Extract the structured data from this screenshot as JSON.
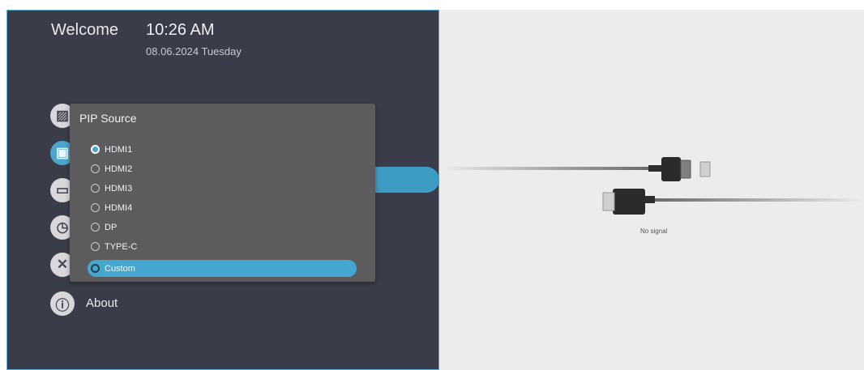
{
  "header": {
    "welcome": "Welcome",
    "time": "10:26 AM",
    "date": "08.06.2024 Tuesday"
  },
  "menu": {
    "items": [
      {
        "icon": "picture-icon",
        "label": ""
      },
      {
        "icon": "display-icon",
        "label": ""
      },
      {
        "icon": "screen-icon",
        "label": ""
      },
      {
        "icon": "clock-icon",
        "label": ""
      },
      {
        "icon": "tools-icon",
        "label": ""
      },
      {
        "icon": "info-icon",
        "label": "About"
      }
    ]
  },
  "dialog": {
    "title": "PIP Source",
    "options": [
      {
        "label": "HDMI1",
        "checked": true,
        "highlighted": false
      },
      {
        "label": "HDMI2",
        "checked": false,
        "highlighted": false
      },
      {
        "label": "HDMI3",
        "checked": false,
        "highlighted": false
      },
      {
        "label": "HDMI4",
        "checked": false,
        "highlighted": false
      },
      {
        "label": "DP",
        "checked": false,
        "highlighted": false
      },
      {
        "label": "TYPE-C",
        "checked": false,
        "highlighted": false
      },
      {
        "label": "Custom",
        "checked": false,
        "highlighted": true
      }
    ]
  },
  "preview": {
    "status": "No signal"
  },
  "colors": {
    "accent": "#45a7cf",
    "panel": "#3a3c49",
    "dialog": "#5c5c5e",
    "preview_bg": "#ececec"
  }
}
